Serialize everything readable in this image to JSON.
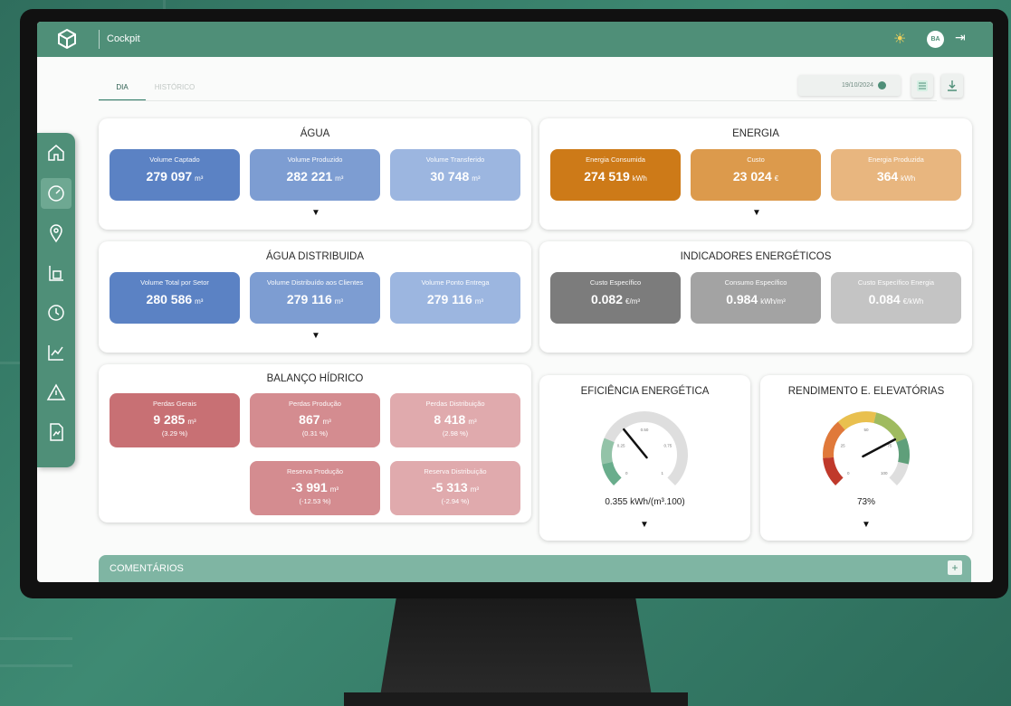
{
  "header": {
    "title": "Cockpit",
    "avatar": "BA"
  },
  "tabs": [
    {
      "label": "DIA",
      "active": true
    },
    {
      "label": "HISTÓRICO",
      "active": false
    }
  ],
  "date": "19/10/2024",
  "sidebar": {
    "items": [
      "home-icon",
      "gauge-icon",
      "map-pin-icon",
      "report-icon",
      "clock-icon",
      "chart-icon",
      "alert-icon",
      "document-chart-icon"
    ],
    "active_index": 1
  },
  "agua": {
    "title": "ÁGUA",
    "cards": [
      {
        "label": "Volume Captado",
        "value": "279 097",
        "unit": "m³"
      },
      {
        "label": "Volume Produzido",
        "value": "282 221",
        "unit": "m³"
      },
      {
        "label": "Volume Transferido",
        "value": "30 748",
        "unit": "m³"
      }
    ]
  },
  "energia": {
    "title": "ENERGIA",
    "cards": [
      {
        "label": "Energia Consumida",
        "value": "274 519",
        "unit": "kWh"
      },
      {
        "label": "Custo",
        "value": "23 024",
        "unit": "€"
      },
      {
        "label": "Energia Produzida",
        "value": "364",
        "unit": "kWh"
      }
    ]
  },
  "agua_distribuida": {
    "title": "ÁGUA DISTRIBUIDA",
    "cards": [
      {
        "label": "Volume Total por Setor",
        "value": "280 586",
        "unit": "m³"
      },
      {
        "label": "Volume Distribuído aos Clientes",
        "value": "279 116",
        "unit": "m³"
      },
      {
        "label": "Volume Ponto Entrega",
        "value": "279 116",
        "unit": "m³"
      }
    ]
  },
  "indicadores": {
    "title": "INDICADORES ENERGÉTICOS",
    "cards": [
      {
        "label": "Custo Específico",
        "value": "0.082",
        "unit": "€/m³"
      },
      {
        "label": "Consumo Específico",
        "value": "0.984",
        "unit": "kWh/m³"
      },
      {
        "label": "Custo Específico Energia",
        "value": "0.084",
        "unit": "€/kWh"
      }
    ]
  },
  "balanco": {
    "title": "BALANÇO HÍDRICO",
    "cards": [
      {
        "label": "Perdas Gerais",
        "value": "9 285",
        "unit": "m³",
        "pct": "(3.29 %)"
      },
      {
        "label": "Perdas Produção",
        "value": "867",
        "unit": "m³",
        "pct": "(0.31 %)"
      },
      {
        "label": "Perdas Distribuição",
        "value": "8 418",
        "unit": "m³",
        "pct": "(2.98 %)"
      },
      {
        "label": "Reserva Produção",
        "value": "-3 991",
        "unit": "m³",
        "pct": "(-12.53 %)"
      },
      {
        "label": "Reserva Distribuição",
        "value": "-5 313",
        "unit": "m³",
        "pct": "(-2.94 %)"
      }
    ]
  },
  "eficiencia": {
    "title": "EFICIÊNCIA ENERGÉTICA",
    "value_label": "0.355 kWh/(m³.100)",
    "value": 0.355,
    "ticks": [
      "0",
      "0.25",
      "0.50",
      "0.75",
      "1"
    ]
  },
  "rendimento": {
    "title": "RENDIMENTO E. ELEVATÓRIAS",
    "value_label": "73%",
    "value": 73,
    "ticks": [
      "0",
      "25",
      "50",
      "75",
      "100"
    ]
  },
  "comments": {
    "label": "COMENTÁRIOS",
    "plus": "+"
  },
  "caret": "▼",
  "colors": {
    "brand": "#4f8f78",
    "blue": [
      "#5b82c4",
      "#7d9dd2",
      "#9cb6e0"
    ],
    "orange": [
      "#cd7a18",
      "#dc9a4c",
      "#e8b67f"
    ],
    "gray": [
      "#7c7c7c",
      "#a3a3a3",
      "#c4c4c4"
    ],
    "red": [
      "#c87074",
      "#d48c90",
      "#e0aaad"
    ]
  }
}
